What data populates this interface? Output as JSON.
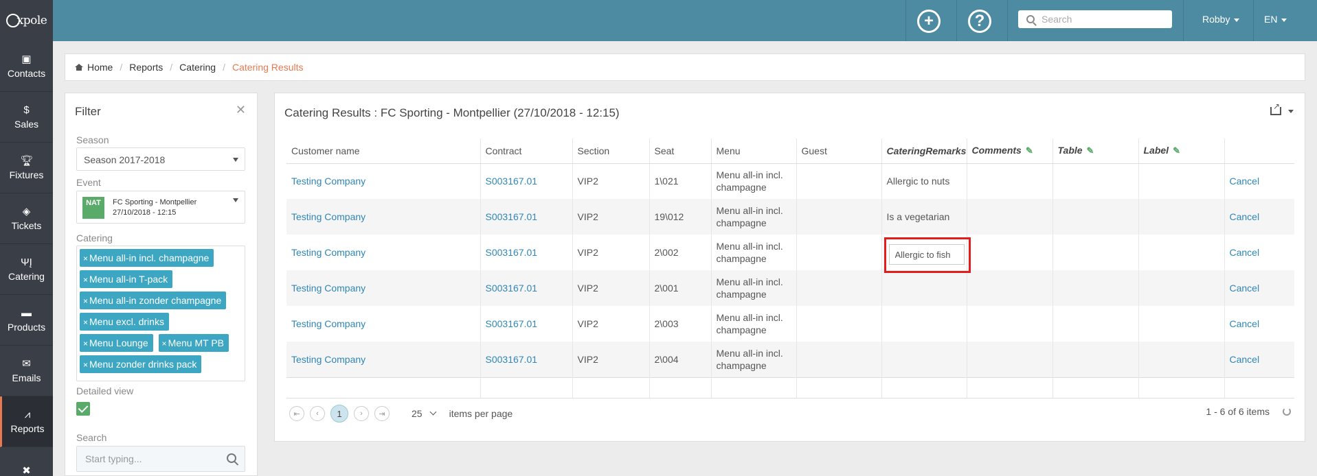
{
  "app": {
    "logo": "xpole",
    "user": "Robby",
    "language": "EN",
    "search_placeholder": "Search"
  },
  "sidebar": {
    "items": [
      {
        "label": "Contacts",
        "icon": "contact-card-icon"
      },
      {
        "label": "Sales",
        "icon": "coin-icon"
      },
      {
        "label": "Fixtures",
        "icon": "trophy-icon"
      },
      {
        "label": "Tickets",
        "icon": "ticket-icon"
      },
      {
        "label": "Catering",
        "icon": "fork-knife-icon"
      },
      {
        "label": "Products",
        "icon": "cart-icon"
      },
      {
        "label": "Emails",
        "icon": "envelope-icon"
      },
      {
        "label": "Reports",
        "icon": "chart-icon",
        "active": true
      },
      {
        "label": "",
        "icon": "tools-icon"
      }
    ]
  },
  "breadcrumb": {
    "items": [
      "Home",
      "Reports",
      "Catering"
    ],
    "current": "Catering Results"
  },
  "filter": {
    "title": "Filter",
    "season_label": "Season",
    "season_value": "Season 2017-2018",
    "event_label": "Event",
    "event_badge": "NAT",
    "event_name": "FC Sporting - Montpellier",
    "event_date": "27/10/2018 - 12:15",
    "catering_label": "Catering",
    "catering_tags": [
      "Menu all-in incl. champagne",
      "Menu all-in T-pack",
      "Menu all-in zonder champagne",
      "Menu excl. drinks",
      "Menu Lounge",
      "Menu MT PB",
      "Menu zonder drinks pack"
    ],
    "detailed_label": "Detailed view",
    "detailed_checked": true,
    "search_label": "Search",
    "search_placeholder": "Start typing..."
  },
  "main": {
    "title": "Catering Results : FC Sporting - Montpellier (27/10/2018 - 12:15)",
    "columns": [
      "Customer name",
      "Contract",
      "Section",
      "Seat",
      "Menu",
      "Guest",
      "CateringRemarks",
      "Comments",
      "Table",
      "Label",
      ""
    ],
    "rows": [
      {
        "customer": "Testing Company",
        "contract": "S003167.01",
        "section": "VIP2",
        "seat": "1\\021",
        "menu": "Menu all-in incl. champagne",
        "guest": "",
        "remarks": "Allergic to nuts",
        "comments": "",
        "table": "",
        "label": "",
        "action": "Cancel"
      },
      {
        "customer": "Testing Company",
        "contract": "S003167.01",
        "section": "VIP2",
        "seat": "19\\012",
        "menu": "Menu all-in incl. champagne",
        "guest": "",
        "remarks": "Is a vegetarian",
        "comments": "",
        "table": "",
        "label": "",
        "action": "Cancel"
      },
      {
        "customer": "Testing Company",
        "contract": "S003167.01",
        "section": "VIP2",
        "seat": "2\\002",
        "menu": "Menu all-in incl. champagne",
        "guest": "",
        "remarks": "Allergic to fish",
        "comments": "",
        "table": "",
        "label": "",
        "action": "Cancel"
      },
      {
        "customer": "Testing Company",
        "contract": "S003167.01",
        "section": "VIP2",
        "seat": "2\\001",
        "menu": "Menu all-in incl. champagne",
        "guest": "",
        "remarks": "",
        "comments": "",
        "table": "",
        "label": "",
        "action": "Cancel"
      },
      {
        "customer": "Testing Company",
        "contract": "S003167.01",
        "section": "VIP2",
        "seat": "2\\003",
        "menu": "Menu all-in incl. champagne",
        "guest": "",
        "remarks": "",
        "comments": "",
        "table": "",
        "label": "",
        "action": "Cancel"
      },
      {
        "customer": "Testing Company",
        "contract": "S003167.01",
        "section": "VIP2",
        "seat": "2\\004",
        "menu": "Menu all-in incl. champagne",
        "guest": "",
        "remarks": "",
        "comments": "",
        "table": "",
        "label": "",
        "action": "Cancel"
      }
    ],
    "editing_row": 2,
    "pager": {
      "current_page": "1",
      "page_size": "25",
      "page_size_label": "items per page",
      "info": "1 - 6 of 6 items"
    }
  }
}
